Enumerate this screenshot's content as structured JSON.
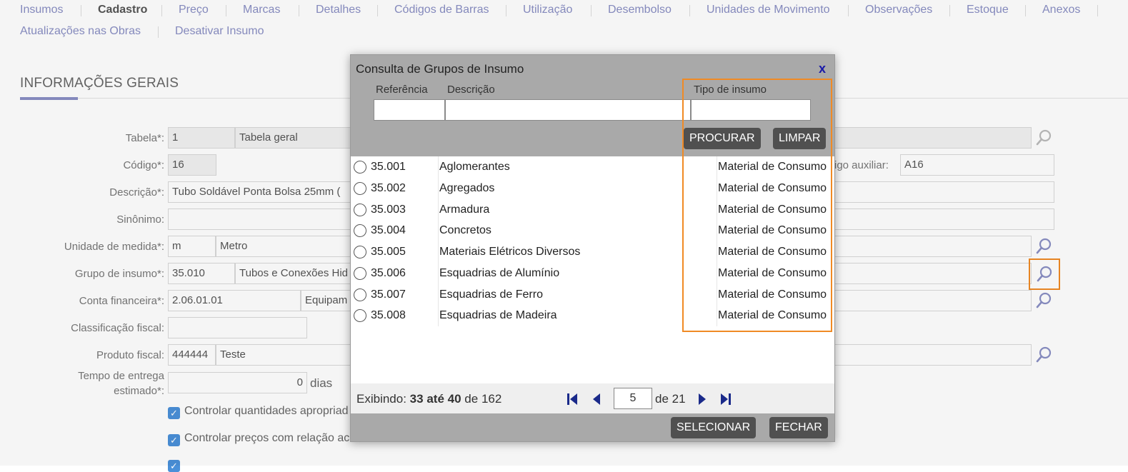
{
  "tabs": {
    "row1": [
      "Insumos",
      "Cadastro",
      "Preço",
      "Marcas",
      "Detalhes",
      "Códigos de Barras",
      "Utilização",
      "Desembolso",
      "Unidades de Movimento",
      "Observações",
      "Estoque",
      "Anexos"
    ],
    "row2": [
      "Atualizações nas Obras",
      "Desativar Insumo"
    ]
  },
  "section": {
    "title": "INFORMAÇÕES GERAIS"
  },
  "form": {
    "tabela_label": "Tabela*:",
    "tabela_code": "1",
    "tabela_name": "Tabela geral",
    "codigo_label": "Código*:",
    "codigo_value": "16",
    "codigo_aux_label": "igo auxiliar:",
    "codigo_aux_value": "A16",
    "descricao_label": "Descrição*:",
    "descricao_value": "Tubo Soldável Ponta Bolsa 25mm (",
    "sinonimo_label": "Sinônimo:",
    "unidade_label": "Unidade de medida*:",
    "unidade_code": "m",
    "unidade_name": "Metro",
    "grupo_label": "Grupo de insumo*:",
    "grupo_code": "35.010",
    "grupo_name": "Tubos e Conexões Hid",
    "conta_label": "Conta financeira*:",
    "conta_code": "2.06.01.01",
    "conta_name": "Equipam",
    "classif_label": "Classificação fiscal:",
    "produto_label": "Produto fiscal:",
    "produto_code": "444444",
    "produto_name": "Teste",
    "tempo_label": "Tempo de entrega estimado*:",
    "tempo_value": "0",
    "tempo_unit": "dias",
    "check1": "Controlar quantidades apropriad",
    "check2": "Controlar preços com relação ac"
  },
  "modal": {
    "title": "Consulta de Grupos de Insumo",
    "close": "x",
    "filter": {
      "ref_label": "Referência",
      "desc_label": "Descrição",
      "tipo_label": "Tipo de insumo",
      "search_btn": "PROCURAR",
      "clear_btn": "LIMPAR"
    },
    "rows": [
      {
        "code": "35.001",
        "desc": "Aglomerantes",
        "tipo": "Material de Consumo"
      },
      {
        "code": "35.002",
        "desc": "Agregados",
        "tipo": "Material de Consumo"
      },
      {
        "code": "35.003",
        "desc": "Armadura",
        "tipo": "Material de Consumo"
      },
      {
        "code": "35.004",
        "desc": "Concretos",
        "tipo": "Material de Consumo"
      },
      {
        "code": "35.005",
        "desc": "Materiais Elétricos Diversos",
        "tipo": "Material de Consumo"
      },
      {
        "code": "35.006",
        "desc": "Esquadrias de Alumínio",
        "tipo": "Material de Consumo"
      },
      {
        "code": "35.007",
        "desc": "Esquadrias de Ferro",
        "tipo": "Material de Consumo"
      },
      {
        "code": "35.008",
        "desc": "Esquadrias de Madeira",
        "tipo": "Material de Consumo"
      }
    ],
    "pager": {
      "prefix": "Exibindo:",
      "from": "33",
      "until_word": "até",
      "to": "40",
      "of_word": "de",
      "total": "162",
      "page": "5",
      "of_pages": "de 21"
    },
    "footer": {
      "select_btn": "SELECIONAR",
      "close_btn": "FECHAR"
    }
  },
  "colors": {
    "highlight": "#f08a24",
    "tab_link": "#8a8fc4",
    "modal_header": "#a9a9a9",
    "button": "#505050"
  }
}
